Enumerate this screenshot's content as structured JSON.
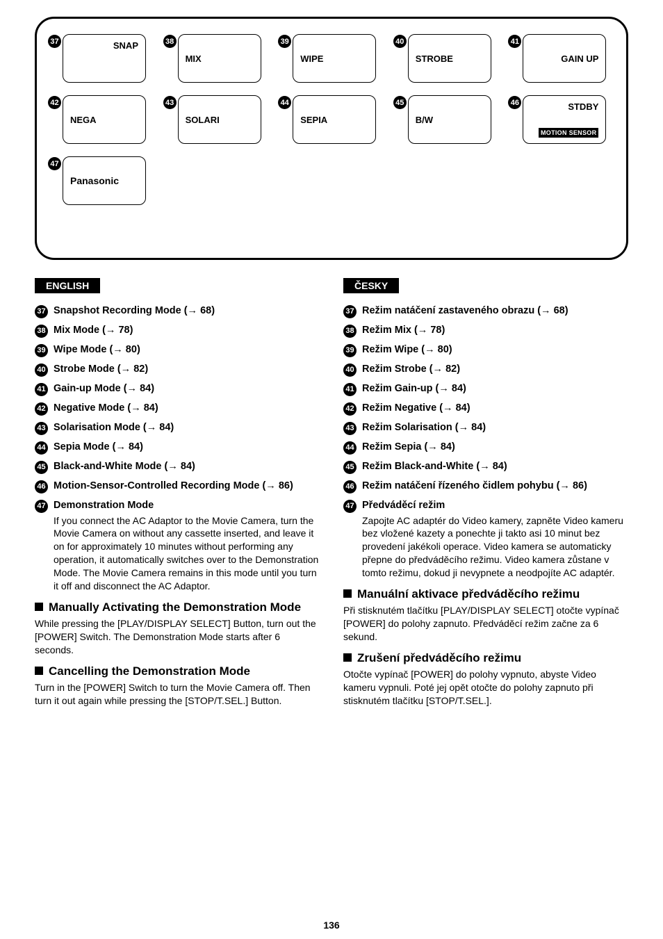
{
  "diagram": {
    "rows": [
      [
        {
          "num": "37",
          "top": "SNAP",
          "mid": "",
          "midAlign": "left",
          "inverse": "",
          "brand": ""
        },
        {
          "num": "38",
          "top": "",
          "mid": "MIX",
          "midAlign": "left",
          "inverse": "",
          "brand": ""
        },
        {
          "num": "39",
          "top": "",
          "mid": "WIPE",
          "midAlign": "left",
          "inverse": "",
          "brand": ""
        },
        {
          "num": "40",
          "top": "",
          "mid": "STROBE",
          "midAlign": "left",
          "inverse": "",
          "brand": ""
        },
        {
          "num": "41",
          "top": "",
          "mid": "GAIN UP",
          "midAlign": "right",
          "inverse": "",
          "brand": ""
        }
      ],
      [
        {
          "num": "42",
          "top": "",
          "mid": "NEGA",
          "midAlign": "left",
          "inverse": "",
          "brand": ""
        },
        {
          "num": "43",
          "top": "",
          "mid": "SOLARI",
          "midAlign": "left",
          "inverse": "",
          "brand": ""
        },
        {
          "num": "44",
          "top": "",
          "mid": "SEPIA",
          "midAlign": "left",
          "inverse": "",
          "brand": ""
        },
        {
          "num": "45",
          "top": "",
          "mid": "B/W",
          "midAlign": "left",
          "inverse": "",
          "brand": ""
        },
        {
          "num": "46",
          "top": "STDBY",
          "mid": "",
          "midAlign": "left",
          "inverse": "MOTION SENSOR",
          "brand": ""
        }
      ],
      [
        {
          "num": "47",
          "top": "",
          "mid": "",
          "midAlign": "left",
          "inverse": "",
          "brand": "Panasonic"
        },
        null,
        null,
        null,
        null
      ]
    ]
  },
  "columns": [
    {
      "lang": "ENGLISH",
      "items": [
        {
          "num": "37",
          "title": "Snapshot Recording Mode",
          "ref": "68",
          "desc": ""
        },
        {
          "num": "38",
          "title": "Mix Mode",
          "ref": "78",
          "desc": ""
        },
        {
          "num": "39",
          "title": "Wipe Mode",
          "ref": "80",
          "desc": ""
        },
        {
          "num": "40",
          "title": "Strobe Mode",
          "ref": "82",
          "desc": ""
        },
        {
          "num": "41",
          "title": "Gain-up Mode",
          "ref": "84",
          "desc": ""
        },
        {
          "num": "42",
          "title": "Negative Mode",
          "ref": "84",
          "desc": ""
        },
        {
          "num": "43",
          "title": "Solarisation Mode",
          "ref": "84",
          "desc": ""
        },
        {
          "num": "44",
          "title": "Sepia Mode",
          "ref": "84",
          "desc": ""
        },
        {
          "num": "45",
          "title": "Black-and-White Mode",
          "ref": "84",
          "desc": ""
        },
        {
          "num": "46",
          "title": "Motion-Sensor-Controlled Recording Mode",
          "ref": "86",
          "desc": ""
        },
        {
          "num": "47",
          "title": "Demonstration Mode",
          "ref": "",
          "desc": "If you connect the AC Adaptor to the Movie Camera, turn the Movie Camera on without any cassette inserted, and leave it on for approximately 10 minutes without performing any operation, it automatically switches over to the Demonstration Mode. The Movie Camera remains in this mode until you turn it off and disconnect the AC Adaptor."
        }
      ],
      "sections": [
        {
          "title": "Manually Activating the Demonstration Mode",
          "body": "While pressing the [PLAY/DISPLAY SELECT] Button, turn out the [POWER] Switch. The Demonstration Mode starts after 6 seconds."
        },
        {
          "title": "Cancelling the Demonstration Mode",
          "body": "Turn in the [POWER] Switch to turn the Movie Camera off. Then turn it out again while pressing the [STOP/T.SEL.] Button."
        }
      ]
    },
    {
      "lang": "ČESKY",
      "items": [
        {
          "num": "37",
          "title": "Režim natáčení zastaveného obrazu",
          "ref": "68",
          "desc": ""
        },
        {
          "num": "38",
          "title": "Režim Mix",
          "ref": "78",
          "desc": ""
        },
        {
          "num": "39",
          "title": "Režim Wipe",
          "ref": "80",
          "desc": ""
        },
        {
          "num": "40",
          "title": "Režim Strobe",
          "ref": "82",
          "desc": ""
        },
        {
          "num": "41",
          "title": "Režim Gain-up",
          "ref": "84",
          "desc": ""
        },
        {
          "num": "42",
          "title": "Režim Negative",
          "ref": "84",
          "desc": ""
        },
        {
          "num": "43",
          "title": "Režim Solarisation",
          "ref": "84",
          "desc": ""
        },
        {
          "num": "44",
          "title": "Režim Sepia",
          "ref": "84",
          "desc": ""
        },
        {
          "num": "45",
          "title": "Režim Black-and-White",
          "ref": "84",
          "desc": ""
        },
        {
          "num": "46",
          "title": "Režim natáčení řízeného čidlem pohybu",
          "ref": "86",
          "desc": ""
        },
        {
          "num": "47",
          "title": "Předváděcí režim",
          "ref": "",
          "desc": "Zapojte AC adaptér do Video kamery, zapněte Video kameru bez vložené kazety a ponechte ji takto asi 10 minut bez provedení jakékoli operace. Video kamera se automaticky přepne do předváděcího režimu. Video kamera zůstane v tomto režimu, dokud ji nevypnete a neodpojíte AC adaptér."
        }
      ],
      "sections": [
        {
          "title": "Manuální aktivace předváděcího režimu",
          "body": "Při stisknutém tlačítku [PLAY/DISPLAY SELECT] otočte vypínač [POWER] do polohy zapnuto. Předváděcí režim začne za 6 sekund."
        },
        {
          "title": "Zrušení předváděcího režimu",
          "body": "Otočte vypínač [POWER] do polohy vypnuto, abyste Video kameru vypnuli. Poté jej opět otočte do polohy zapnuto při stisknutém tlačítku [STOP/T.SEL.]."
        }
      ]
    }
  ],
  "pageNumber": "136"
}
